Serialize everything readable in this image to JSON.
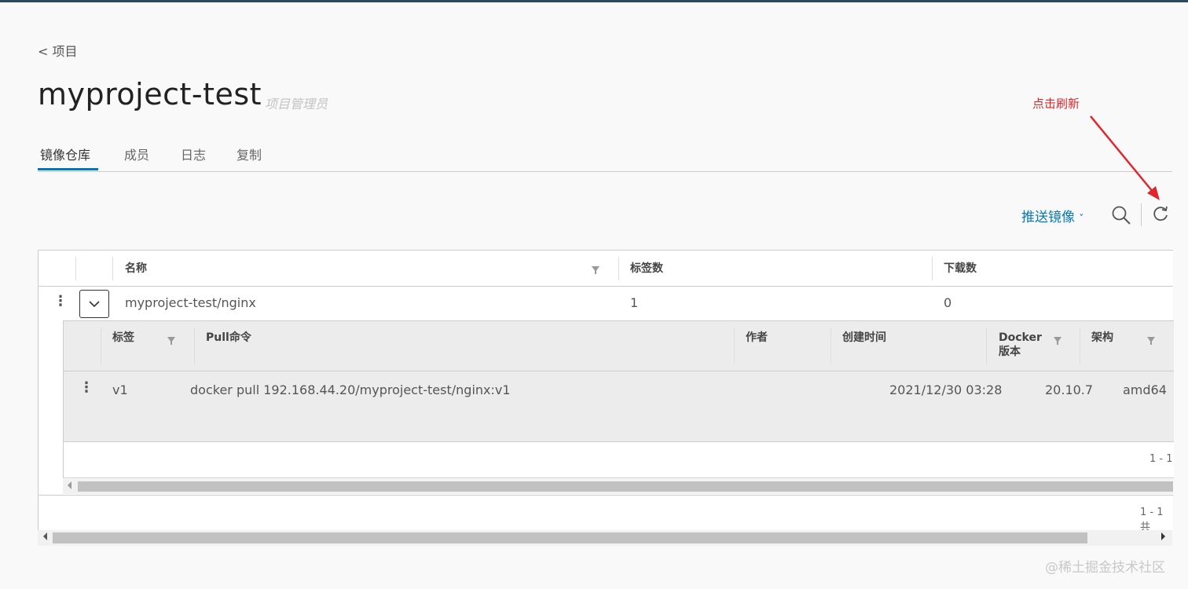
{
  "nav": {
    "back_label": "< 项目"
  },
  "project": {
    "name": "myproject-test",
    "role": "项目管理员"
  },
  "tabs": [
    {
      "label": "镜像仓库",
      "active": true
    },
    {
      "label": "成员",
      "active": false
    },
    {
      "label": "日志",
      "active": false
    },
    {
      "label": "复制",
      "active": false
    }
  ],
  "annotation": {
    "text": "点击刷新",
    "color": "#e0262c"
  },
  "toolbar": {
    "push_label": "推送镜像",
    "push_caret": "˅",
    "search_icon": "search-icon",
    "refresh_icon": "refresh-icon"
  },
  "repo_table": {
    "columns": [
      "名称",
      "标签数",
      "下载数"
    ],
    "rows": [
      {
        "name": "myproject-test/nginx",
        "tags_count": "1",
        "downloads": "0"
      }
    ],
    "footer": "1 - 1 共"
  },
  "tag_table": {
    "columns": [
      "标签",
      "Pull命令",
      "作者",
      "创建时间",
      "Docker\n版本",
      "架构"
    ],
    "columns_display": {
      "tag": "标签",
      "pull": "Pull命令",
      "author": "作者",
      "created": "创建时间",
      "docker_l1": "Docker",
      "docker_l2": "版本",
      "arch": "架构"
    },
    "rows": [
      {
        "tag": "v1",
        "pull": "docker pull 192.168.44.20/myproject-test/nginx:v1",
        "author": "",
        "created": "2021/12/30 03:28",
        "docker": "20.10.7",
        "arch": "amd64"
      }
    ],
    "footer": "1 - 1"
  },
  "watermark": "@稀土掘金技术社区",
  "colors": {
    "accent": "#0079b8",
    "link": "#0a7ab7",
    "topbar": "#2b4a5e"
  }
}
